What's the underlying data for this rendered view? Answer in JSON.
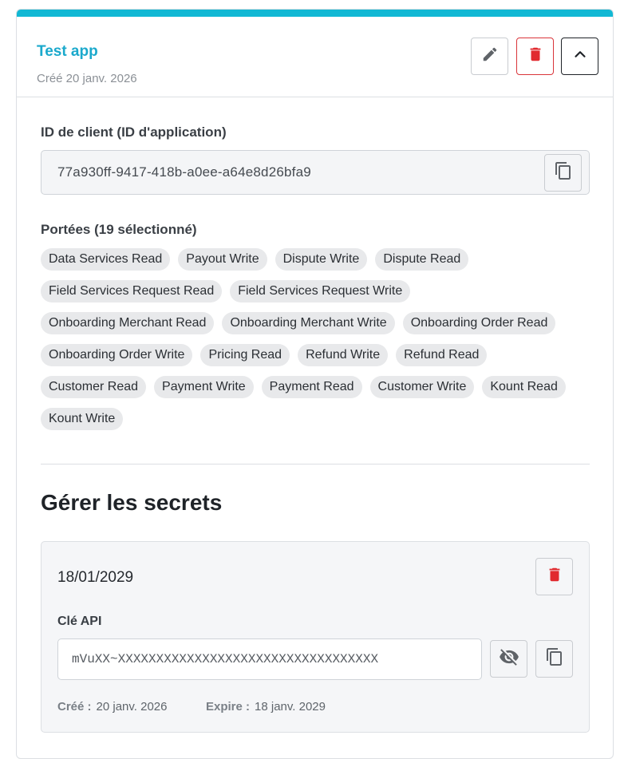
{
  "app": {
    "title": "Test app",
    "created": "Créé 20 janv. 2026"
  },
  "client": {
    "label": "ID de client (ID d'application)",
    "value": "77a930ff-9417-418b-a0ee-a64e8d26bfa9"
  },
  "scopes": {
    "label": "Portées (19 sélectionné)",
    "items": [
      "Data Services Read",
      "Payout Write",
      "Dispute Write",
      "Dispute Read",
      "Field Services Request Read",
      "Field Services Request Write",
      "Onboarding Merchant Read",
      "Onboarding Merchant Write",
      "Onboarding Order Read",
      "Onboarding Order Write",
      "Pricing Read",
      "Refund Write",
      "Refund Read",
      "Customer Read",
      "Payment Write",
      "Payment Read",
      "Customer Write",
      "Kount Read",
      "Kount Write"
    ]
  },
  "secrets": {
    "title": "Gérer les secrets",
    "item": {
      "date": "18/01/2029",
      "api_label": "Clé API",
      "api_value": "mVuXX~XXXXXXXXXXXXXXXXXXXXXXXXXXXXXXXXXX",
      "created_label": "Créé :",
      "created_value": "20 janv. 2026",
      "expire_label": "Expire :",
      "expire_value": "18 janv. 2029"
    }
  },
  "colors": {
    "accent": "#12b8d4",
    "title": "#1ba9cc",
    "danger": "#d9343a"
  },
  "icons": [
    "pencil-icon",
    "trash-icon",
    "chevron-up-icon",
    "copy-icon",
    "eye-off-icon"
  ]
}
